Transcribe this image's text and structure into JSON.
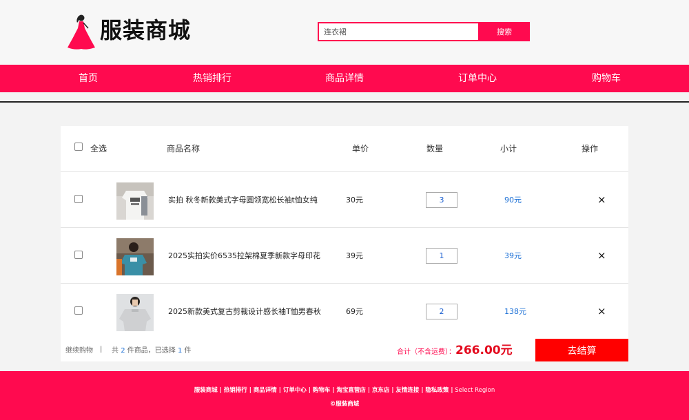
{
  "header": {
    "brand": "服装商城",
    "search": {
      "value": "连衣裙",
      "button_label": "搜索"
    }
  },
  "nav": {
    "items": [
      {
        "label": "首页"
      },
      {
        "label": "热销排行"
      },
      {
        "label": "商品详情"
      },
      {
        "label": "订单中心"
      },
      {
        "label": "购物车"
      }
    ]
  },
  "cart": {
    "columns": {
      "select_all": "全选",
      "name": "商品名称",
      "price": "单价",
      "quantity": "数量",
      "subtotal": "小计",
      "action": "操作"
    },
    "items": [
      {
        "name": "实拍 秋冬新款美式字母圆领宽松长袖t恤女纯",
        "price": "30元",
        "quantity": "3",
        "subtotal": "90元",
        "remove": "×"
      },
      {
        "name": "2025实拍实价6535拉架棉夏季新款字母印花",
        "price": "39元",
        "quantity": "1",
        "subtotal": "39元",
        "remove": "×"
      },
      {
        "name": "2025新款美式复古剪裁设计感长袖T恤男春秋",
        "price": "69元",
        "quantity": "2",
        "subtotal": "138元",
        "remove": "×"
      }
    ],
    "footer": {
      "continue": "继续购物",
      "separator": "|",
      "summary_prefix": "共",
      "total_count": "2",
      "summary_mid": "件商品，已选择",
      "selected_count": "1",
      "summary_suffix": "件",
      "total_label": "合计（不含运费）：",
      "total_amount": "266.00元",
      "checkout_label": "去结算"
    }
  },
  "footer": {
    "links": "服装商城 | 热销排行 | 商品详情 | 订单中心 | 购物车 | 淘宝直营店 | 京东店 | 友情连接 | 隐私政策 |",
    "region": " Select Region",
    "copyright": "©服装商城"
  },
  "colors": {
    "accent": "#ff0a4f",
    "checkout": "#ff0000",
    "link_blue": "#1a6fd6"
  }
}
